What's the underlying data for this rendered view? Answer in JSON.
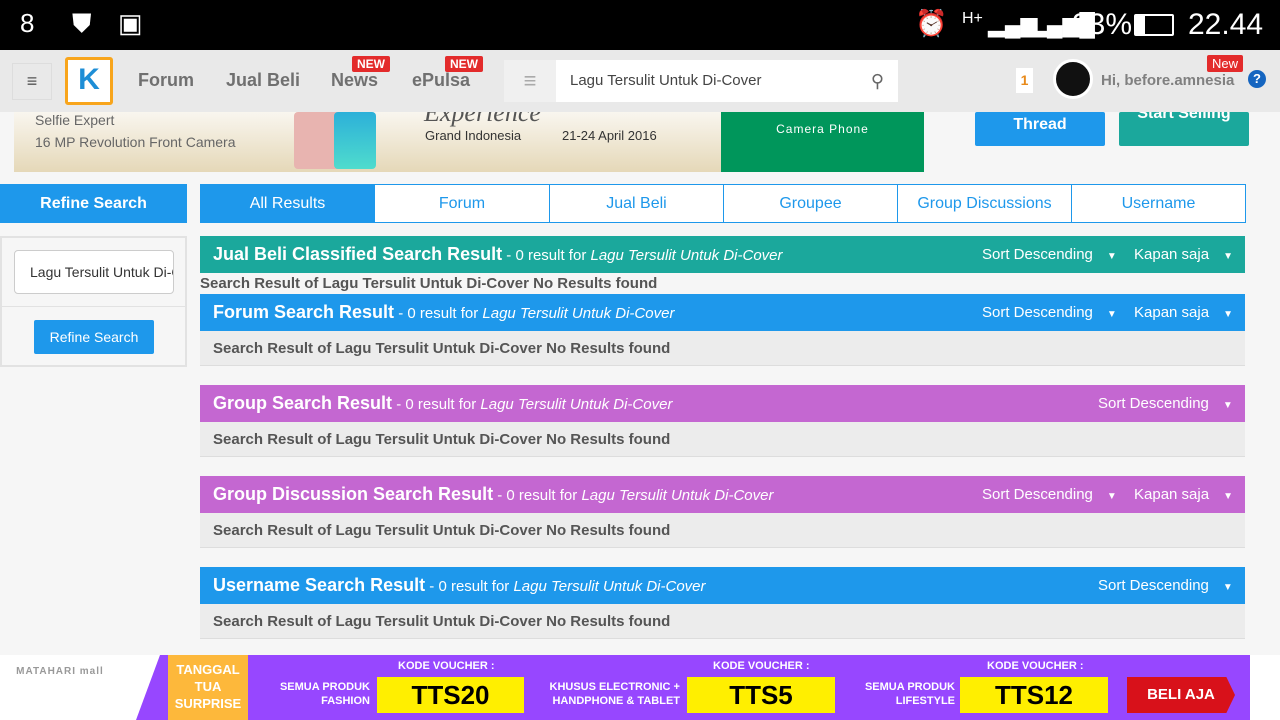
{
  "status_bar": {
    "battery": "23%",
    "time": "22.44",
    "network": "H+"
  },
  "nav": {
    "links": [
      "Forum",
      "Jual Beli",
      "News",
      "ePulsa"
    ],
    "new_badge": "NEW",
    "search_value": "Lagu Tersulit Untuk Di-Cover",
    "notif_count": "1",
    "greeting": "Hi, before.amnesia",
    "user_new_badge": "New"
  },
  "banner": {
    "line1": "Selfie Expert",
    "line2": "16 MP Revolution Front Camera",
    "headline": "Experience",
    "venue": "Grand Indonesia",
    "dates": "21-24 April 2016",
    "camera": "Camera  Phone"
  },
  "actions": {
    "thread": "Thread",
    "start_selling": "Start Selling"
  },
  "sidebar": {
    "title": "Refine Search",
    "input_value": "Lagu Tersulit Untuk Di-Cover",
    "button": "Refine Search"
  },
  "tabs": [
    "All Results",
    "Forum",
    "Jual Beli",
    "Groupee",
    "Group Discussions",
    "Username"
  ],
  "sections": [
    {
      "title": "Jual Beli Classified Search Result",
      "count": " - 0 result for ",
      "query": "Lagu Tersulit Untuk Di-Cover",
      "sort": "Sort Descending",
      "time": "Kapan saja",
      "message": "Search Result of Lagu Tersulit Untuk Di-Cover No Results found",
      "color": "#1ba89c"
    },
    {
      "title": "Forum Search Result",
      "count": " - 0 result for ",
      "query": "Lagu Tersulit Untuk Di-Cover",
      "sort": "Sort Descending",
      "time": "Kapan saja",
      "message": "Search Result of Lagu Tersulit Untuk Di-Cover No Results found",
      "color": "#1e98eb"
    },
    {
      "title": "Group Search Result",
      "count": " - 0 result for ",
      "query": "Lagu Tersulit Untuk Di-Cover",
      "sort": "Sort Descending",
      "message": "Search Result of Lagu Tersulit Untuk Di-Cover No Results found",
      "color": "#c467d1"
    },
    {
      "title": "Group Discussion Search Result",
      "count": " - 0 result for ",
      "query": "Lagu Tersulit Untuk Di-Cover",
      "sort": "Sort Descending",
      "time": "Kapan saja",
      "message": "Search Result of Lagu Tersulit Untuk Di-Cover No Results found",
      "color": "#c467d1"
    },
    {
      "title": "Username Search Result",
      "count": " - 0 result for ",
      "query": "Lagu Tersulit Untuk Di-Cover",
      "sort": "Sort Descending",
      "message": "Search Result of Lagu Tersulit Untuk Di-Cover No Results found",
      "color": "#1e98eb"
    }
  ],
  "ad": {
    "brand": "MATAHARI mall",
    "promo": "TANGGAL TUA SURPRISE",
    "kode": "KODE VOUCHER :",
    "items": [
      {
        "desc": "SEMUA PRODUK FASHION",
        "code": "TTS20"
      },
      {
        "desc": "KHUSUS ELECTRONIC + HANDPHONE & TABLET",
        "code": "TTS5"
      },
      {
        "desc": "SEMUA PRODUK LIFESTYLE",
        "code": "TTS12"
      }
    ],
    "cta": "BELI AJA"
  }
}
